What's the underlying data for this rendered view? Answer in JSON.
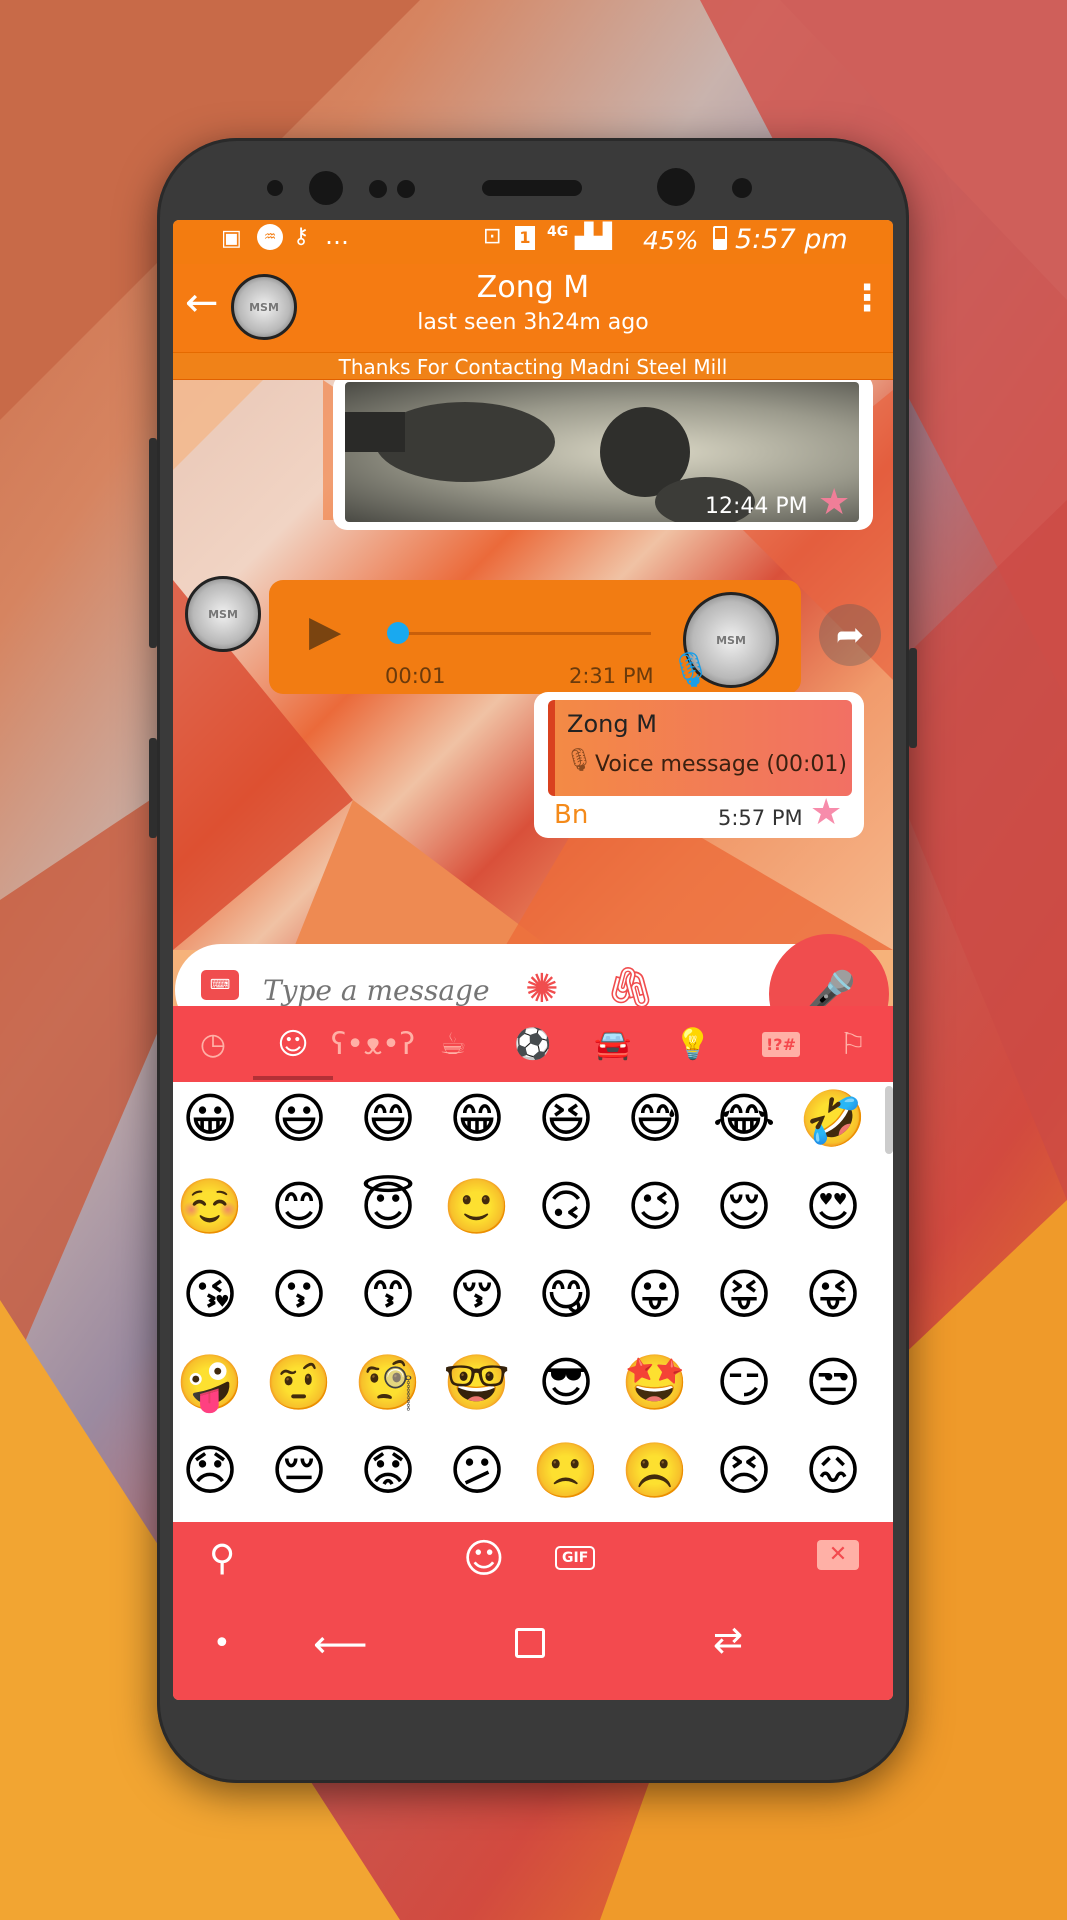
{
  "status_bar": {
    "battery": "45%",
    "time": "5:57 pm",
    "network": "4G",
    "more": "…",
    "sim": "1"
  },
  "header": {
    "contact_name": "Zong M",
    "last_seen": "last seen 3h24m ago",
    "avatar_text": "MSM"
  },
  "banner": {
    "text": "Thanks For Contacting Madni Steel Mill"
  },
  "messages": {
    "image": {
      "time": "12:44 PM"
    },
    "voice": {
      "duration": "00:01",
      "time": "2:31 PM",
      "avatar_text": "MSM"
    },
    "reply": {
      "quoted_name": "Zong M",
      "quoted_text": "Voice message (00:01)",
      "body": "Bn",
      "time": "5:57 PM"
    }
  },
  "composer": {
    "placeholder": "Type a message"
  },
  "emoji_tabs": [
    "recent",
    "smileys",
    "animals",
    "food",
    "sports",
    "travel",
    "objects",
    "symbols",
    "flags"
  ],
  "emoji_tab_labels": {
    "symbols": "!?#"
  },
  "emoji_rows": [
    [
      "😀",
      "😃",
      "😄",
      "😁",
      "😆",
      "😅",
      "😂",
      "🤣"
    ],
    [
      "☺️",
      "😊",
      "😇",
      "🙂",
      "🙃",
      "😉",
      "😌",
      "😍"
    ],
    [
      "😘",
      "😗",
      "😙",
      "😚",
      "😋",
      "😛",
      "😝",
      "😜"
    ],
    [
      "🤪",
      "🤨",
      "🧐",
      "🤓",
      "😎",
      "🤩",
      "😏",
      "😒"
    ],
    [
      "😞",
      "😔",
      "😟",
      "😕",
      "🙁",
      "☹️",
      "😣",
      "😖"
    ]
  ],
  "keyboard_bar": {
    "gif_label": "GIF"
  },
  "colors": {
    "appbar": "#f57b12",
    "keyboard": "#f34a4e",
    "accent": "#f04d4e"
  }
}
